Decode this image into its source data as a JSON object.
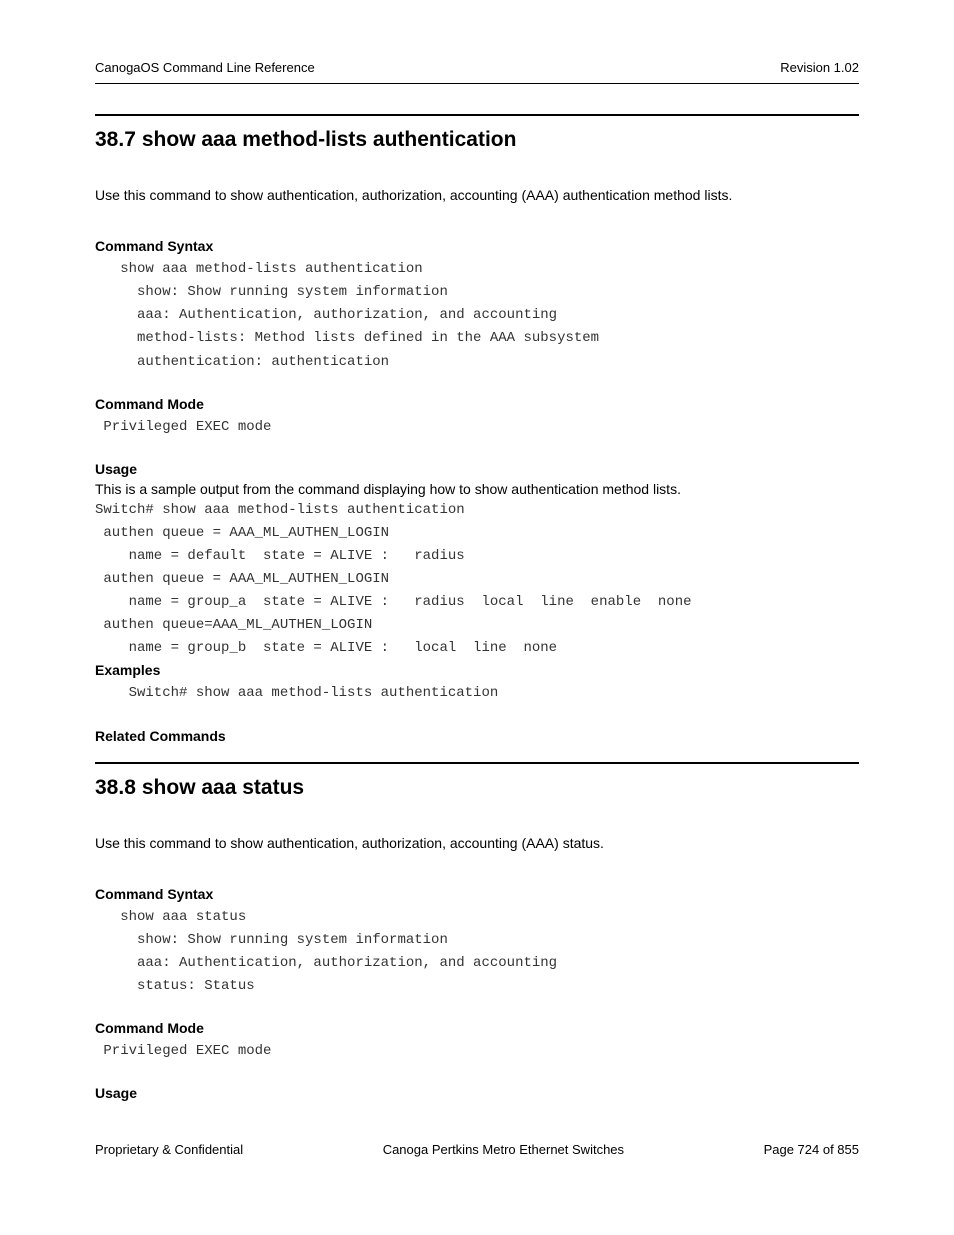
{
  "header": {
    "left": "CanogaOS Command Line Reference",
    "right": "Revision 1.02"
  },
  "section1": {
    "number": "38.7",
    "title": "show aaa method-lists authentication",
    "intro": "Use this command to show authentication, authorization, accounting (AAA) authentication method lists.",
    "syntax_label": "Command Syntax",
    "syntax_code": "   show aaa method-lists authentication\n     show: Show running system information\n     aaa: Authentication, authorization, and accounting\n     method-lists: Method lists defined in the AAA subsystem\n     authentication: authentication",
    "mode_label": "Command Mode",
    "mode_code": " Privileged EXEC mode",
    "usage_label": "Usage",
    "usage_text": "This is a sample output from the command displaying how to show authentication method lists.",
    "usage_code": "Switch# show aaa method-lists authentication\n authen queue = AAA_ML_AUTHEN_LOGIN\n    name = default  state = ALIVE :   radius\n authen queue = AAA_ML_AUTHEN_LOGIN\n    name = group_a  state = ALIVE :   radius  local  line  enable  none\n authen queue=AAA_ML_AUTHEN_LOGIN\n    name = group_b  state = ALIVE :   local  line  none",
    "examples_label": "Examples",
    "examples_code": "    Switch# show aaa method-lists authentication",
    "related_label": "Related Commands"
  },
  "section2": {
    "number": "38.8",
    "title": "show aaa status",
    "intro": "Use this command to show authentication, authorization, accounting (AAA) status.",
    "syntax_label": "Command Syntax",
    "syntax_code": "   show aaa status\n     show: Show running system information\n     aaa: Authentication, authorization, and accounting\n     status: Status",
    "mode_label": "Command Mode",
    "mode_code": " Privileged EXEC mode",
    "usage_label": "Usage"
  },
  "footer": {
    "left": "Proprietary & Confidential",
    "center": "Canoga Pertkins Metro Ethernet Switches",
    "right": "Page 724 of 855"
  }
}
